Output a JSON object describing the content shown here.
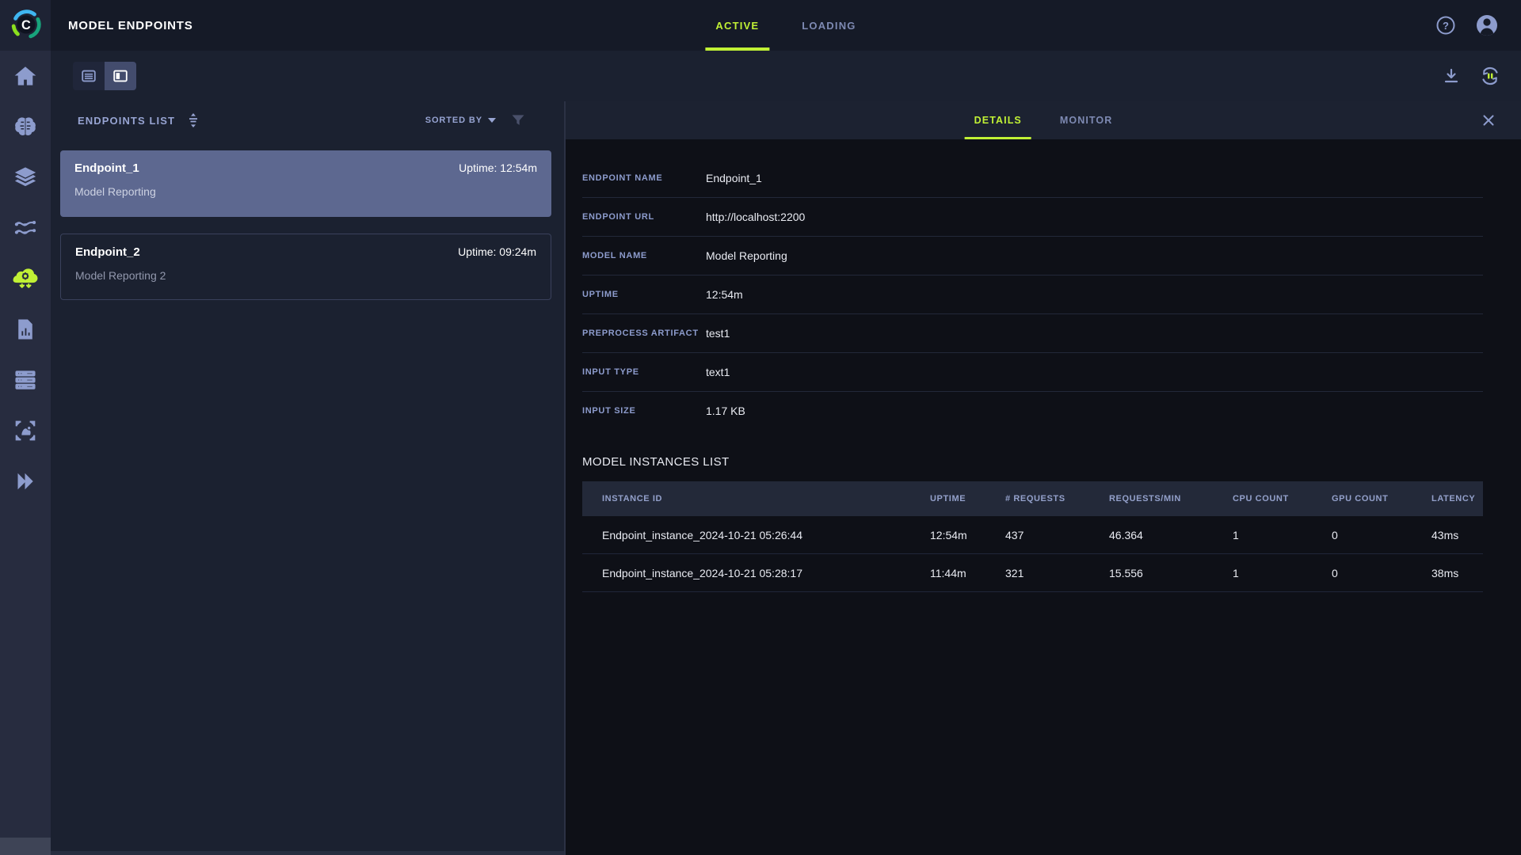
{
  "colors": {
    "accent": "#c1f135",
    "icon": "#8d9ccd",
    "selected_card": "#5d6890"
  },
  "topbar": {
    "title": "MODEL ENDPOINTS",
    "tabs": [
      {
        "label": "ACTIVE"
      },
      {
        "label": "LOADING"
      }
    ],
    "icons": [
      "help-icon",
      "user-avatar-icon"
    ]
  },
  "sidebar": {
    "items": [
      "home",
      "projects-brain",
      "datasets-layers",
      "pipelines",
      "model-serving",
      "reports",
      "workers-queues",
      "hyper-datasets",
      "expand"
    ],
    "active_item": "model-serving"
  },
  "toolbar": {
    "view_toggle": [
      "table-view",
      "details-view"
    ],
    "active_view": "details-view",
    "icons": [
      "download",
      "auto-refresh-pause"
    ]
  },
  "endpoints_list": {
    "title": "ENDPOINTS LIST",
    "sort_label": "SORTED BY",
    "items": [
      {
        "name": "Endpoint_1",
        "uptime": "Uptime: 12:54m",
        "model": "Model Reporting",
        "selected": true
      },
      {
        "name": "Endpoint_2",
        "uptime": "Uptime: 09:24m",
        "model": "Model Reporting 2",
        "selected": false
      }
    ]
  },
  "details": {
    "tabs": [
      {
        "label": "DETAILS"
      },
      {
        "label": "MONITOR"
      }
    ],
    "fields": [
      {
        "label": "ENDPOINT NAME",
        "value": "Endpoint_1"
      },
      {
        "label": "ENDPOINT URL",
        "value": "http://localhost:2200"
      },
      {
        "label": "MODEL NAME",
        "value": "Model Reporting"
      },
      {
        "label": "UPTIME",
        "value": "12:54m"
      },
      {
        "label": "PREPROCESS ARTIFACT",
        "value": "test1"
      },
      {
        "label": "INPUT TYPE",
        "value": "text1"
      },
      {
        "label": "INPUT SIZE",
        "value": "1.17 KB"
      }
    ],
    "instances": {
      "title": "MODEL INSTANCES LIST",
      "columns": [
        "INSTANCE ID",
        "UPTIME",
        "# REQUESTS",
        "REQUESTS/MIN",
        "CPU COUNT",
        "GPU COUNT",
        "LATENCY"
      ],
      "rows": [
        {
          "id": "Endpoint_instance_2024-10-21 05:26:44",
          "uptime": "12:54m",
          "requests": "437",
          "rpm": "46.364",
          "cpu": "1",
          "gpu": "0",
          "latency": "43ms"
        },
        {
          "id": "Endpoint_instance_2024-10-21 05:28:17",
          "uptime": "11:44m",
          "requests": "321",
          "rpm": "15.556",
          "cpu": "1",
          "gpu": "0",
          "latency": "38ms"
        }
      ]
    }
  }
}
